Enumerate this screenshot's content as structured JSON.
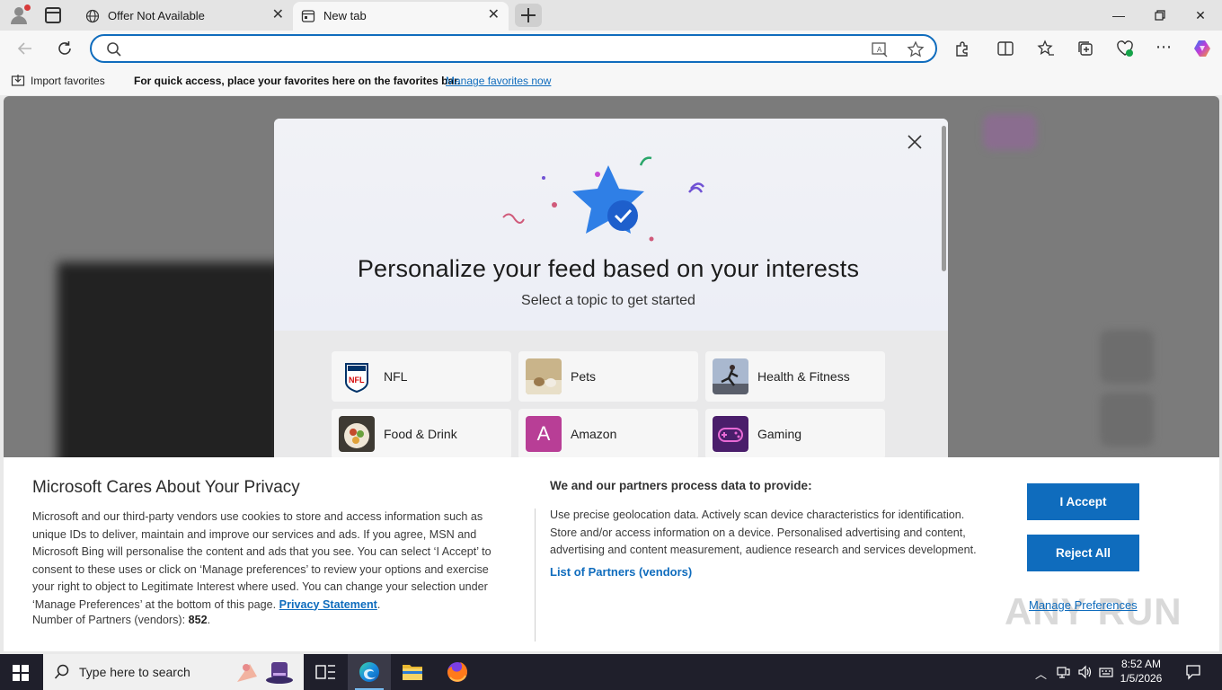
{
  "tabs": [
    {
      "label": "Offer Not Available",
      "active": false
    },
    {
      "label": "New tab",
      "active": true
    }
  ],
  "address_bar": {
    "value": "",
    "placeholder": ""
  },
  "favorites_bar": {
    "import_label": "Import favorites",
    "hint": "For quick access, place your favorites here on the favorites bar.",
    "manage_link": "Manage favorites now"
  },
  "personalize_modal": {
    "title": "Personalize your feed based on your interests",
    "subtitle": "Select a topic to get started",
    "topics": [
      {
        "label": "NFL",
        "icon": "nfl-logo-icon"
      },
      {
        "label": "Pets",
        "icon": "pets-photo-icon"
      },
      {
        "label": "Health & Fitness",
        "icon": "fitness-photo-icon"
      },
      {
        "label": "Food & Drink",
        "icon": "food-photo-icon"
      },
      {
        "label": "Amazon",
        "icon": "amazon-letter-icon",
        "letter": "A"
      },
      {
        "label": "Gaming",
        "icon": "gamepad-icon"
      }
    ]
  },
  "privacy_banner": {
    "title": "Microsoft Cares About Your Privacy",
    "body": "Microsoft and our third-party vendors use cookies to store and access information such as unique IDs to deliver, maintain and improve our services and ads. If you agree, MSN and Microsoft Bing will personalise the content and ads that you see. You can select ‘I Accept’ to consent to these uses or click on ‘Manage preferences’ to review your options and exercise your right to object to Legitimate Interest where used.  You can change your selection under ‘Manage Preferences’ at the bottom of this page.",
    "privacy_link": "Privacy Statement",
    "partners_label": "Number of Partners (vendors):",
    "partners_count": "852",
    "process_title": "We and our partners process data to provide:",
    "process_body": "Use precise geolocation data. Actively scan device characteristics for identification. Store and/or access information on a device. Personalised advertising and content, advertising and content measurement, audience research and services development.",
    "vendors_link": "List of Partners (vendors)",
    "accept_label": "I Accept",
    "reject_label": "Reject All",
    "manage_label": "Manage Preferences",
    "watermark": "ANY RUN"
  },
  "taskbar": {
    "search_placeholder": "Type here to search",
    "time": "8:52 AM",
    "date": "1/5/2026"
  },
  "colors": {
    "accent": "#0f6cbd",
    "taskbar": "#1f1f2b"
  }
}
